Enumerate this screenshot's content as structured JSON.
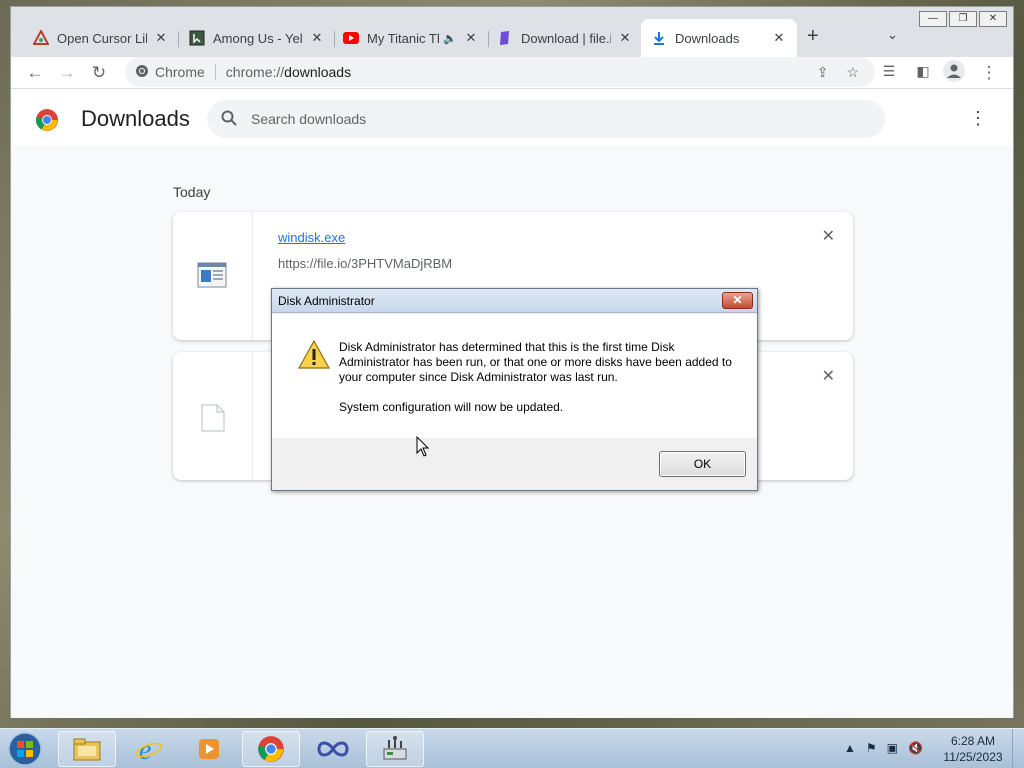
{
  "browser": {
    "tabs": [
      {
        "title": "Open Cursor Libr",
        "icon": "opencursor-favicon",
        "active": false
      },
      {
        "title": "Among Us - Yello",
        "icon": "image-favicon",
        "active": false
      },
      {
        "title": "My Titanic Th",
        "icon": "youtube-favicon",
        "active": false,
        "audio": true
      },
      {
        "title": "Download | file.io",
        "icon": "fileio-favicon",
        "active": false
      },
      {
        "title": "Downloads",
        "icon": "download-favicon",
        "active": true
      }
    ],
    "new_tab": "+",
    "omnibox": {
      "site_label": "Chrome",
      "url_scheme": "chrome://",
      "url_path": "downloads"
    }
  },
  "page": {
    "title": "Downloads",
    "search_placeholder": "Search downloads",
    "date_label": "Today",
    "items": [
      {
        "filename": "windisk.exe",
        "url": "https://file.io/3PHTVMaDjRBM",
        "icon": "exe-file-icon"
      },
      {
        "filename": "",
        "url": "",
        "icon": "blank-file-icon"
      }
    ]
  },
  "dialog": {
    "title": "Disk Administrator",
    "message": "Disk Administrator has determined that this is the first time Disk Administrator has been run, or that one or more disks have been added to your computer since Disk Administrator was last run.",
    "message2": "System configuration will now be updated.",
    "ok_label": "OK",
    "icon": "warning-icon"
  },
  "taskbar": {
    "time": "6:28 AM",
    "date": "11/25/2023",
    "items": [
      "explorer-icon",
      "ie-icon",
      "media-player-icon",
      "chrome-icon",
      "infinity-app-icon",
      "disk-admin-icon"
    ]
  }
}
